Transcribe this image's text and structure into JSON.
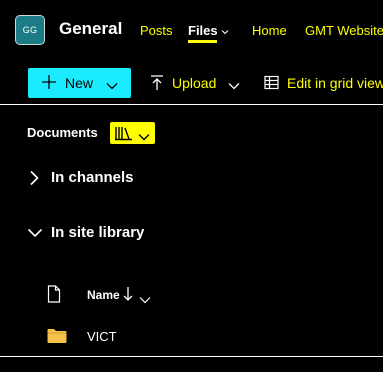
{
  "header": {
    "avatar_initials": "GG",
    "team_name": "General",
    "tabs": [
      {
        "label": "Posts"
      },
      {
        "label": "Files",
        "active": true
      },
      {
        "label": "Home"
      },
      {
        "label": "GMT Website"
      }
    ]
  },
  "toolbar": {
    "new_label": "New",
    "upload_label": "Upload",
    "grid_label": "Edit in grid view"
  },
  "documents": {
    "title": "Documents",
    "sections": [
      {
        "label": "In channels",
        "expanded": false
      },
      {
        "label": "In site library",
        "expanded": true
      }
    ],
    "columns": {
      "name_label": "Name",
      "sort": "descending"
    },
    "items": [
      {
        "name": "VICT",
        "type": "folder"
      }
    ]
  },
  "colors": {
    "background": "#000000",
    "text": "#ffffff",
    "accent_yellow": "#ffff00",
    "accent_cyan": "#1aebff",
    "avatar_bg": "#1c7c86",
    "folder": "#f4c04a"
  }
}
